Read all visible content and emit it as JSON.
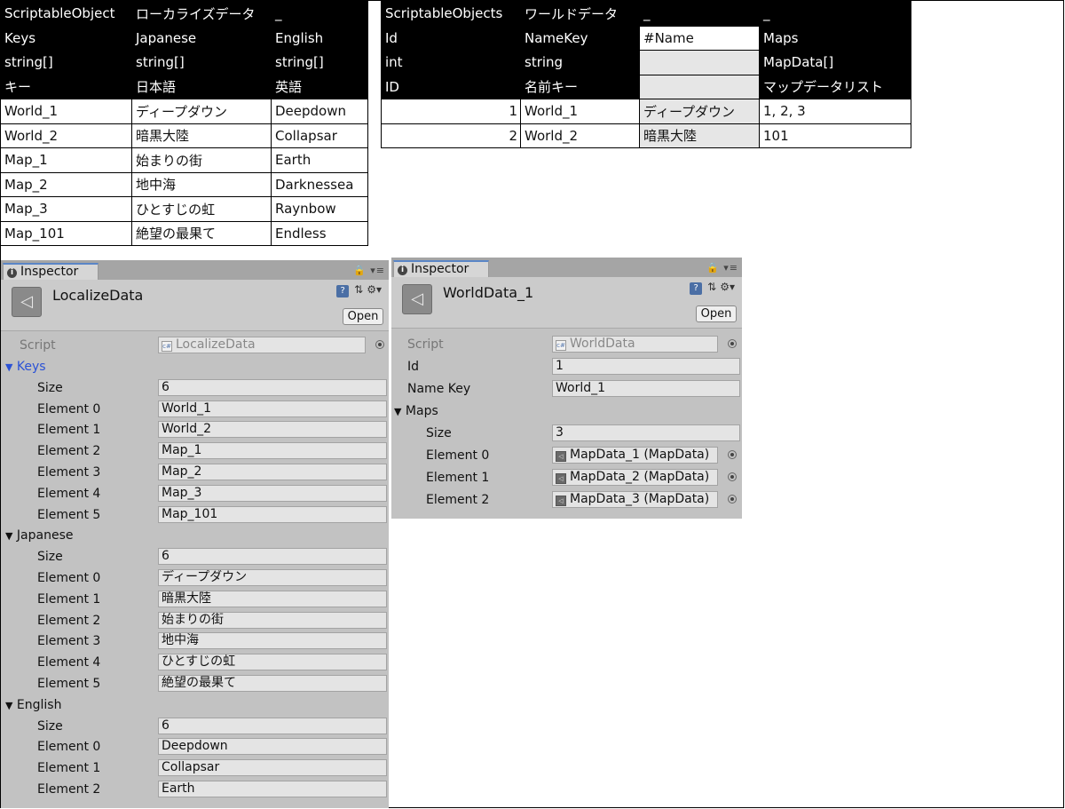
{
  "localize_table": {
    "header_rows": [
      [
        "ScriptableObject",
        "ローカライズデータ",
        "_"
      ],
      [
        "Keys",
        "Japanese",
        "English"
      ],
      [
        "string[]",
        "string[]",
        "string[]"
      ],
      [
        "キー",
        "日本語",
        "英語"
      ]
    ],
    "rows": [
      [
        "World_1",
        "ディープダウン",
        "Deepdown"
      ],
      [
        "World_2",
        "暗黒大陸",
        "Collapsar"
      ],
      [
        "Map_1",
        "始まりの街",
        "Earth"
      ],
      [
        "Map_2",
        "地中海",
        "Darknessea"
      ],
      [
        "Map_3",
        "ひとすじの虹",
        "Raynbow"
      ],
      [
        "Map_101",
        "絶望の最果て",
        "Endless"
      ]
    ]
  },
  "world_table": {
    "header_rows": [
      [
        "ScriptableObjects",
        "ワールドデータ",
        "_",
        "_"
      ],
      [
        "Id",
        "NameKey",
        "#Name",
        "Maps"
      ],
      [
        "int",
        "string",
        "",
        "MapData[]"
      ],
      [
        "ID",
        "名前キー",
        "",
        "マップデータリスト"
      ]
    ],
    "rows": [
      [
        "1",
        "World_1",
        "ディープダウン",
        "1, 2, 3"
      ],
      [
        "2",
        "World_2",
        "暗黒大陸",
        "101"
      ]
    ]
  },
  "inspector_left": {
    "tab_label": "Inspector",
    "object_name": "LocalizeData",
    "open_label": "Open",
    "script_label": "Script",
    "script_value": "LocalizeData",
    "arrays": [
      {
        "name": "Keys",
        "size_label": "Size",
        "size": "6",
        "elements": [
          {
            "label": "Element 0",
            "value": "World_1"
          },
          {
            "label": "Element 1",
            "value": "World_2"
          },
          {
            "label": "Element 2",
            "value": "Map_1"
          },
          {
            "label": "Element 3",
            "value": "Map_2"
          },
          {
            "label": "Element 4",
            "value": "Map_3"
          },
          {
            "label": "Element 5",
            "value": "Map_101"
          }
        ]
      },
      {
        "name": "Japanese",
        "size_label": "Size",
        "size": "6",
        "elements": [
          {
            "label": "Element 0",
            "value": "ディープダウン"
          },
          {
            "label": "Element 1",
            "value": "暗黒大陸"
          },
          {
            "label": "Element 2",
            "value": "始まりの街"
          },
          {
            "label": "Element 3",
            "value": "地中海"
          },
          {
            "label": "Element 4",
            "value": "ひとすじの虹"
          },
          {
            "label": "Element 5",
            "value": "絶望の最果て"
          }
        ]
      },
      {
        "name": "English",
        "size_label": "Size",
        "size": "6",
        "elements": [
          {
            "label": "Element 0",
            "value": "Deepdown"
          },
          {
            "label": "Element 1",
            "value": "Collapsar"
          },
          {
            "label": "Element 2",
            "value": "Earth"
          }
        ]
      }
    ]
  },
  "inspector_right": {
    "tab_label": "Inspector",
    "object_name": "WorldData_1",
    "open_label": "Open",
    "script_label": "Script",
    "script_value": "WorldData",
    "id_label": "Id",
    "id_value": "1",
    "name_key_label": "Name Key",
    "name_key_value": "World_1",
    "maps_label": "Maps",
    "size_label": "Size",
    "size_value": "3",
    "elements": [
      {
        "label": "Element 0",
        "value": "MapData_1 (MapData)"
      },
      {
        "label": "Element 1",
        "value": "MapData_2 (MapData)"
      },
      {
        "label": "Element 2",
        "value": "MapData_3 (MapData)"
      }
    ]
  },
  "colors": {
    "header_bg": "#000000",
    "inspector_bg": "#c2c2c2",
    "foldout_active": "#2b52d6"
  }
}
